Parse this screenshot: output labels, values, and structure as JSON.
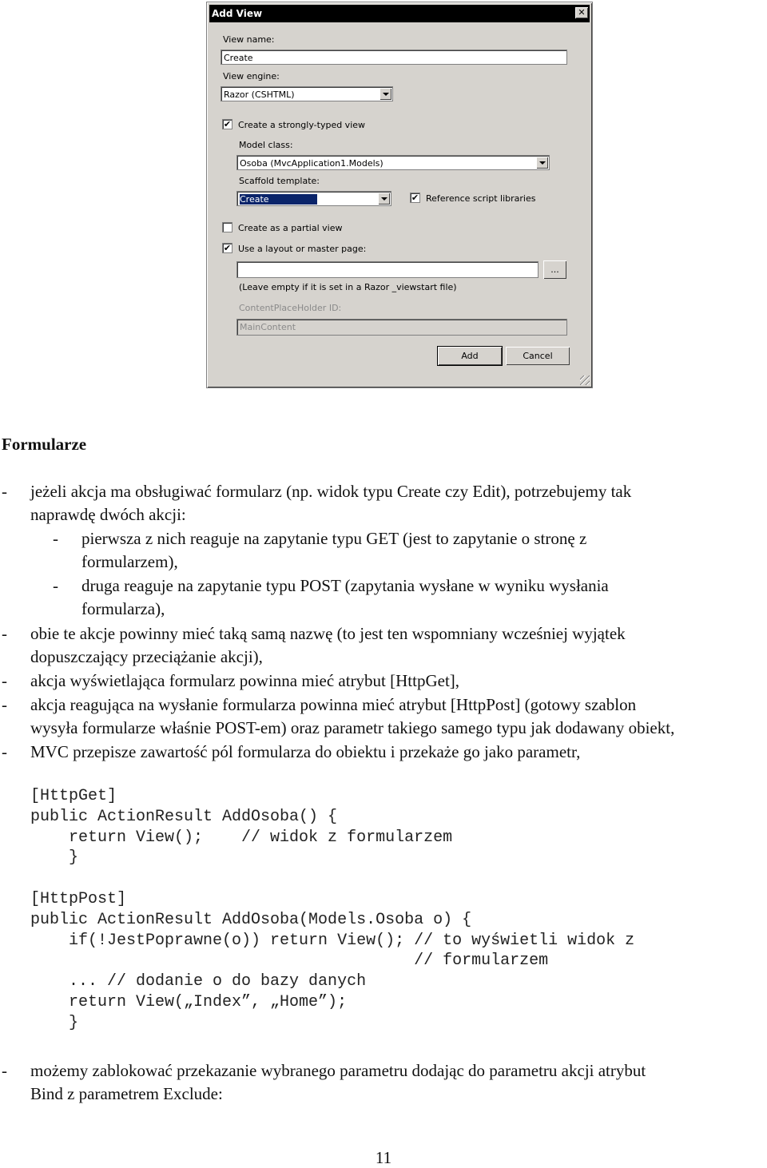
{
  "dialog": {
    "title": "Add View",
    "close_glyph": "✕",
    "view_name_label": "View name:",
    "view_name_value": "Create",
    "view_engine_label": "View engine:",
    "view_engine_value": "Razor (CSHTML)",
    "strongly_typed_label": "Create a strongly-typed view",
    "strongly_typed_checked": true,
    "model_class_label": "Model class:",
    "model_class_value": "Osoba (MvcApplication1.Models)",
    "scaffold_label": "Scaffold template:",
    "scaffold_value": "Create",
    "reference_scripts_label": "Reference script libraries",
    "reference_scripts_checked": true,
    "partial_view_label": "Create as a partial view",
    "partial_view_checked": false,
    "layout_label": "Use a layout or master page:",
    "layout_checked": true,
    "layout_value": "",
    "browse_label": "...",
    "layout_hint": "(Leave empty if it is set in a Razor _viewstart file)",
    "placeholder_id_label": "ContentPlaceHolder ID:",
    "placeholder_id_value": "MainContent",
    "add_label": "Add",
    "cancel_label": "Cancel",
    "check_glyph": "✔"
  },
  "document": {
    "heading": "Formularze",
    "dash": "-",
    "lines": [
      "jeżeli akcja ma obsługiwać formularz (np. widok typu Create czy Edit), potrzebujemy tak",
      "naprawdę dwóch akcji:",
      "pierwsza z nich reaguje na zapytanie typu GET (jest to zapytanie o stronę z",
      "formularzem),",
      "druga reaguje na zapytanie typu POST (zapytania wysłane w wyniku wysłania",
      "formularza),",
      "obie te akcje powinny mieć taką samą nazwę (to jest ten wspomniany wcześniej wyjątek",
      "dopuszczający przeciążanie akcji),",
      "akcja wyświetlająca formularz powinna mieć atrybut [HttpGet],",
      "akcja reagująca na wysłanie formularza powinna mieć atrybut [HttpPost] (gotowy szablon",
      "wysyła formularze właśnie POST-em) oraz parametr takiego samego typu jak dodawany obiekt,",
      "MVC przepisze zawartość pól formularza do obiektu i przekaże go jako parametr,",
      "możemy zablokować przekazanie wybranego parametru dodając do parametru akcji atrybut",
      "Bind z parametrem Exclude:"
    ],
    "code": [
      "[HttpGet]",
      "public ActionResult AddOsoba() {",
      "    return View();    // widok z formularzem",
      "    }",
      "",
      "[HttpPost]",
      "public ActionResult AddOsoba(Models.Osoba o) {",
      "    if(!JestPoprawne(o)) return View(); // to wyświetli widok z",
      "                                        // formularzem",
      "    ... // dodanie o do bazy danych",
      "    return View(„Index”, „Home”);",
      "    }"
    ],
    "page_number": "11"
  }
}
